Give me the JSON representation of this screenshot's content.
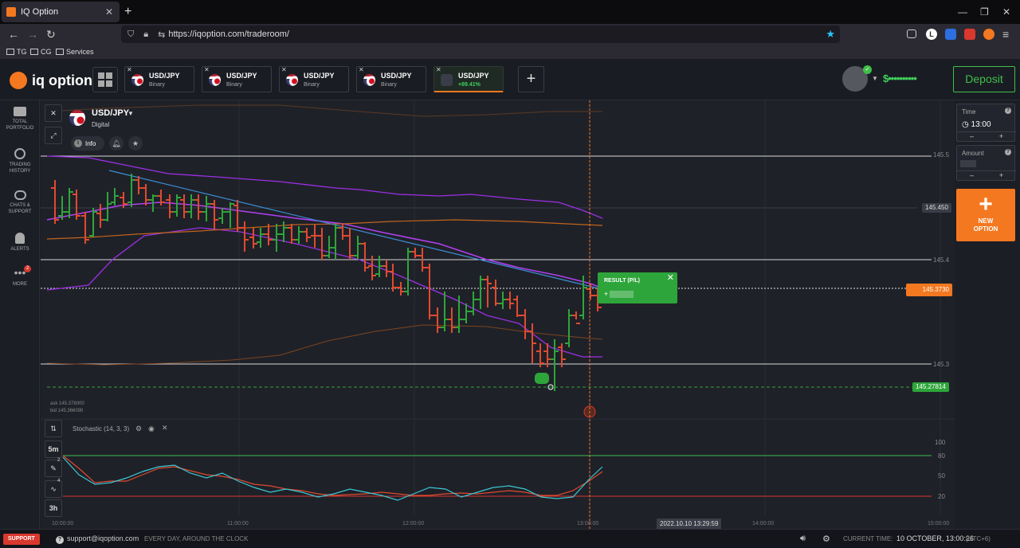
{
  "browser": {
    "tab_title": "IQ Option",
    "url": "https://iqoption.com/traderoom/",
    "bookmarks": [
      "TG",
      "CG",
      "Services"
    ]
  },
  "header": {
    "logo_text": "iq option",
    "asset_tabs": [
      {
        "name": "USD/JPY",
        "sub": "Binary"
      },
      {
        "name": "USD/JPY",
        "sub": "Binary"
      },
      {
        "name": "USD/JPY",
        "sub": "Binary"
      },
      {
        "name": "USD/JPY",
        "sub": "Binary"
      },
      {
        "name": "USD/JPY",
        "sub": "+89.41%"
      }
    ],
    "balance": "$••••••••••",
    "deposit_label": "Deposit"
  },
  "sidebar": {
    "items": [
      {
        "label": "TOTAL PORTFOLIO",
        "icon": "briefcase-icon"
      },
      {
        "label": "TRADING HISTORY",
        "icon": "history-icon"
      },
      {
        "label": "CHATS & SUPPORT",
        "icon": "chat-icon"
      },
      {
        "label": "ALERTS",
        "icon": "bell-icon"
      },
      {
        "label": "MORE",
        "icon": "more-icon",
        "badge": "2"
      }
    ]
  },
  "chart": {
    "asset_title": "USD/JPY",
    "asset_sub": "Digital",
    "info_label": "Info",
    "price_levels": [
      "145.5",
      "145.450",
      "145.4",
      "145.3730",
      "145.3",
      "145.27814"
    ],
    "ask": "ask 145.378000",
    "bid": "bid 145.366090",
    "result_title": "RESULT (P/L)",
    "result_value": "+",
    "indicator": "Stochastic (14, 3, 3)",
    "stoch_levels": [
      "100",
      "80",
      "50",
      "20"
    ],
    "time_ticks": [
      "10:00:00",
      "11:00:00",
      "12:00:00",
      "13:00:00",
      "14:00:00",
      "15:00:00"
    ],
    "cursor_time": "2022.10.10 13:29:59",
    "timeframe": "5m",
    "range": "3h",
    "tool_badges": [
      "2",
      "4"
    ],
    "colors": {
      "up": "#2ea53a",
      "down": "#e04a2f",
      "accent": "#f47820",
      "purple": "#9b30e6",
      "orange_band": "#c0641c",
      "blue_trend": "#3c8fd6"
    }
  },
  "right_panel": {
    "time_label": "Time",
    "time_value": "13:00",
    "amount_label": "Amount",
    "new_option_line1": "NEW",
    "new_option_line2": "OPTION"
  },
  "footer": {
    "support_label": "SUPPORT",
    "support_email": "support@iqoption.com",
    "tagline": "EVERY DAY, AROUND THE CLOCK",
    "current_time_label": "CURRENT TIME:",
    "current_time_value": "10 OCTOBER, 13:00:26",
    "timezone": "(UTC+6)"
  }
}
